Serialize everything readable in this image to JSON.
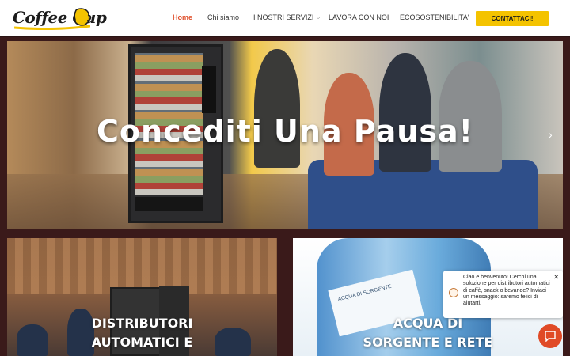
{
  "logo": {
    "text": "Coffee Cup"
  },
  "nav": {
    "home": "Home",
    "chi_siamo": "Chi siamo",
    "servizi": "I NOSTRI SERVIZI",
    "lavora": "LAVORA CON NOI",
    "eco": "ECOSOSTENIBILITA'",
    "contact": "CONTATTACI!"
  },
  "hero": {
    "title": "Concediti Una Pausa!"
  },
  "cards": {
    "left": {
      "line1": "DISTRIBUTORI",
      "line2": "AUTOMATICI E"
    },
    "right": {
      "line1": "ACQUA DI",
      "line2": "SORGENTE E RETE",
      "bottle_label": "ACQUA DI SORGENTE"
    }
  },
  "chat": {
    "message": "Ciao e benvenuto! Cerchi una soluzione per distributori automatici di caffè, snack o bevande? Inviaci un messaggio: saremo felici di aiutarti."
  },
  "colors": {
    "accent": "#e0522e",
    "cta": "#f4c300",
    "chat_button": "#e04a26"
  }
}
